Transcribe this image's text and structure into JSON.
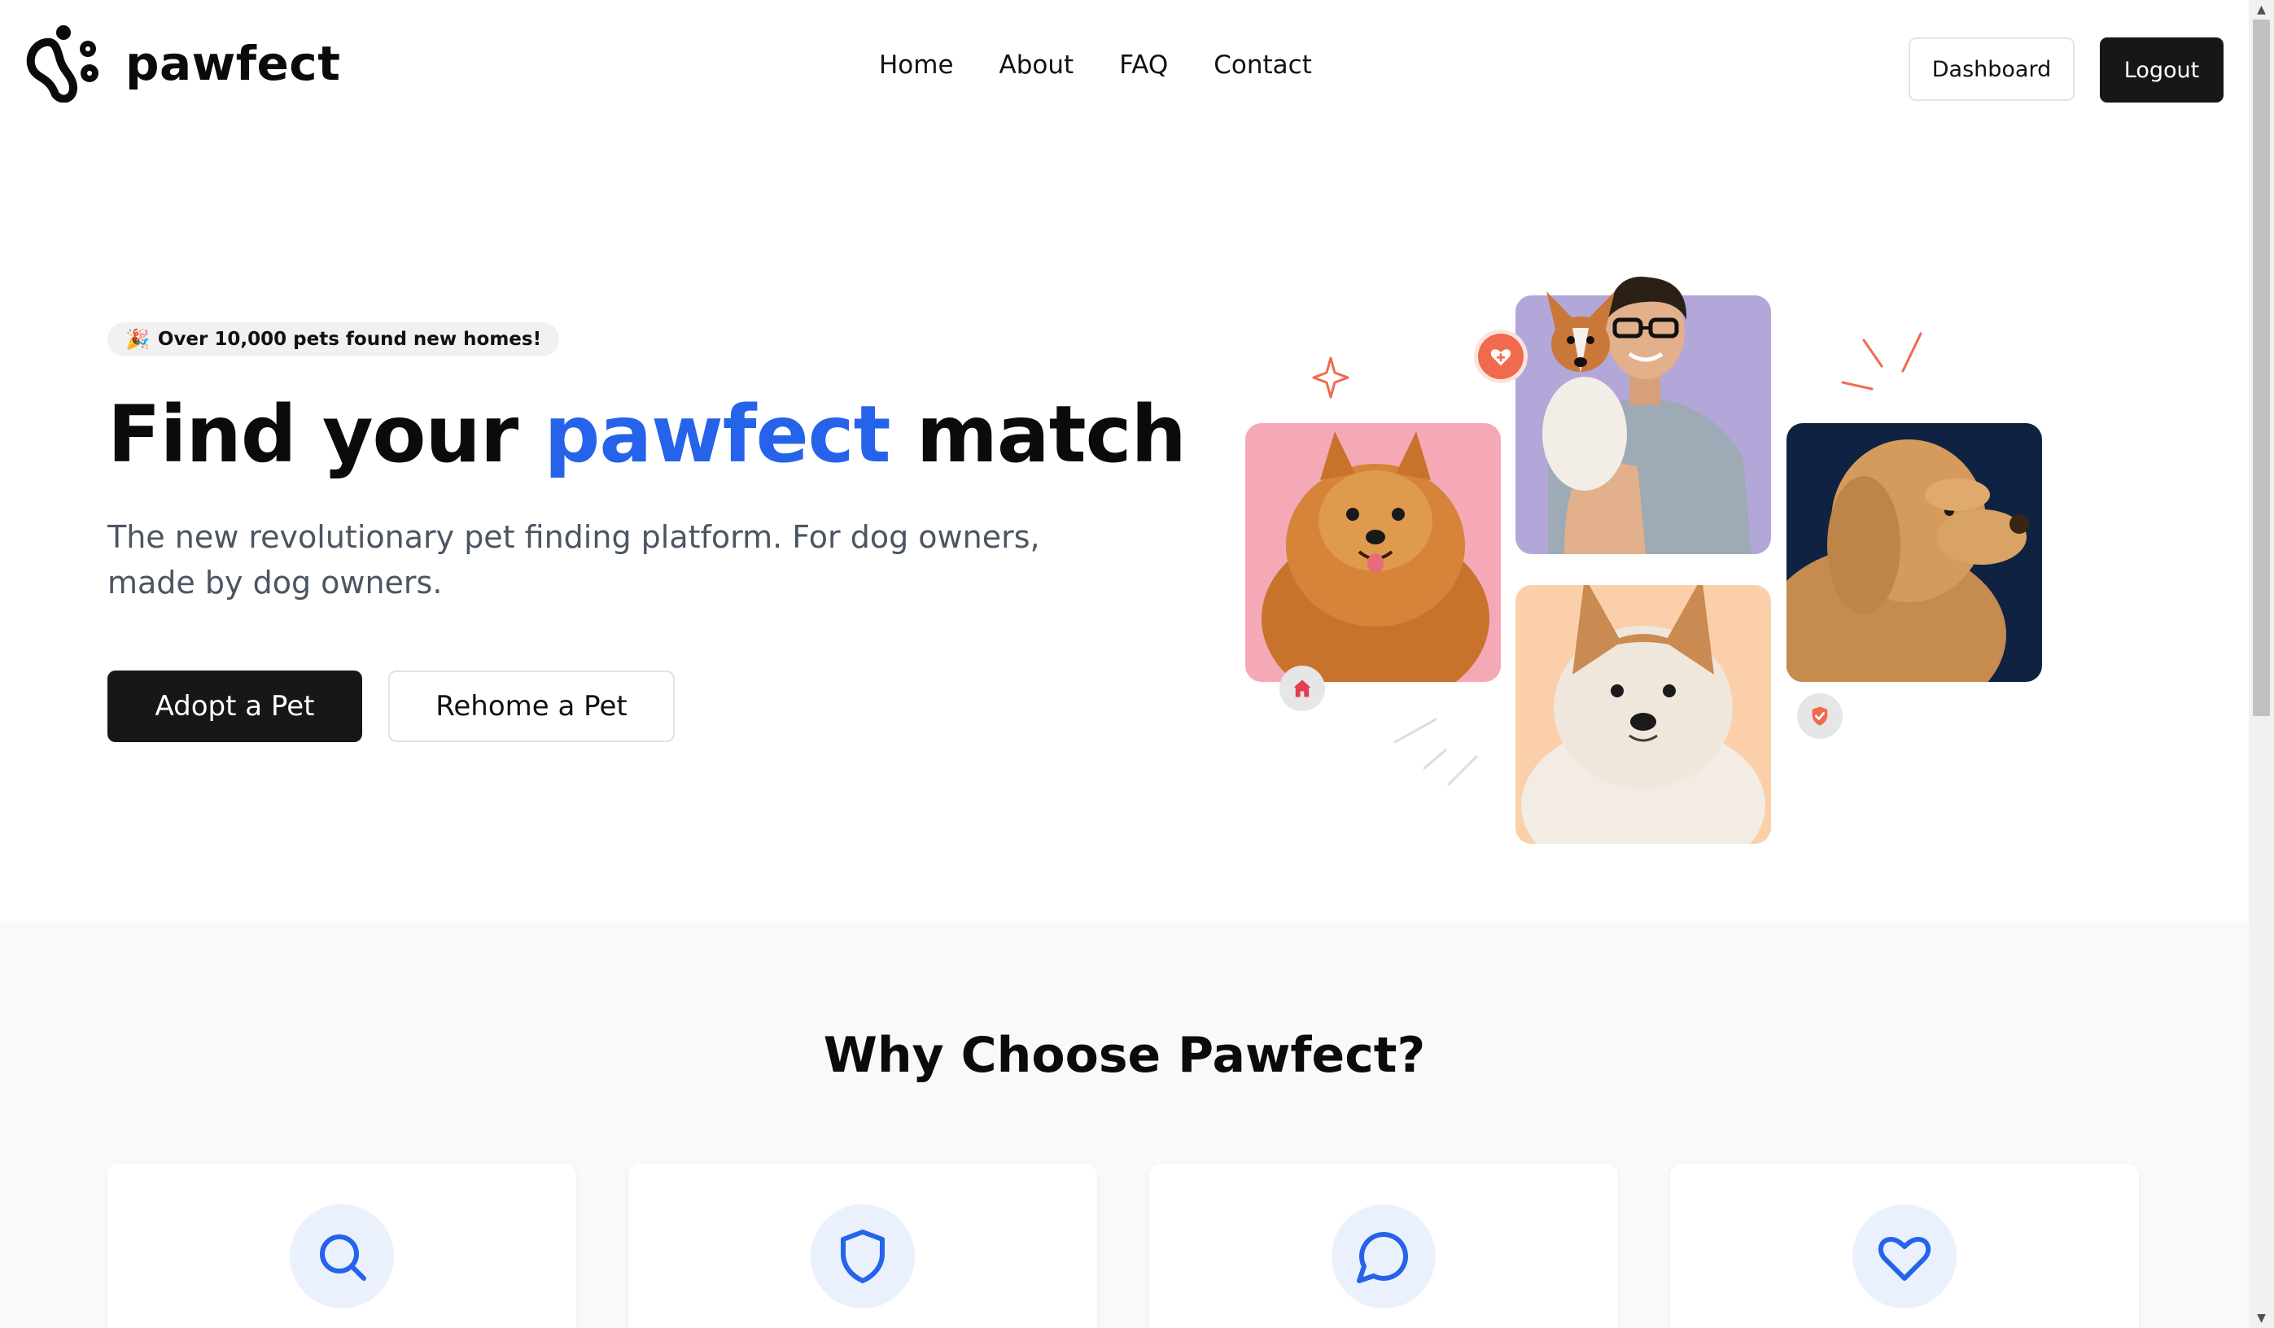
{
  "header": {
    "brand": "pawfect",
    "nav": [
      "Home",
      "About",
      "FAQ",
      "Contact"
    ],
    "dashboard_label": "Dashboard",
    "logout_label": "Logout"
  },
  "hero": {
    "badge_emoji": "🎉",
    "badge_text": "Over 10,000 pets found new homes!",
    "title_prefix": "Find your ",
    "title_accent": "pawfect",
    "title_suffix": " match",
    "subtitle": "The new revolutionary pet finding platform. For dog owners, made by dog owners.",
    "adopt_label": "Adopt a Pet",
    "rehome_label": "Rehome a Pet"
  },
  "features": {
    "title": "Why Choose Pawfect?",
    "cards": [
      {
        "icon": "search-icon"
      },
      {
        "icon": "shield-icon"
      },
      {
        "icon": "chat-bubble-icon"
      },
      {
        "icon": "heart-icon"
      }
    ]
  },
  "colors": {
    "accent": "#2563eb",
    "primary_button": "#171717",
    "pomeranian_card": "#f5a9b6",
    "man_card": "#b3a7d9",
    "poodle_card": "#0f2241",
    "husky_card": "#fbcfaa",
    "feature_icon_bg": "#eaf1fd",
    "heart_badge": "#f06a4f"
  }
}
